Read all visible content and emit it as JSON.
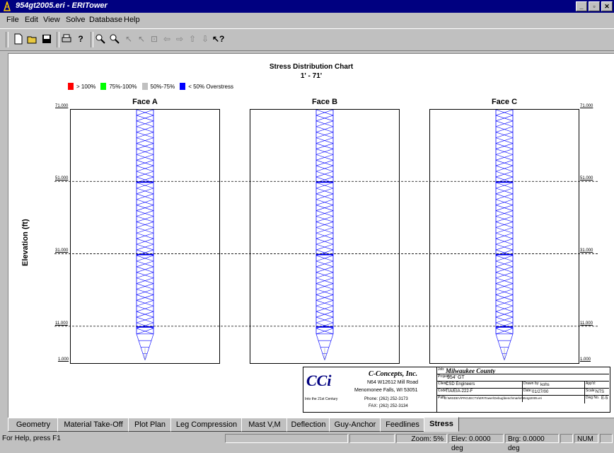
{
  "window": {
    "title": "954gt2005.eri - ERITower"
  },
  "menu": [
    "File",
    "Edit",
    "View",
    "Solve",
    "Database",
    "Help"
  ],
  "toolbar_icons": [
    "new-icon",
    "open-icon",
    "save-icon",
    "print-icon",
    "help-about-icon",
    "zoom-in-icon",
    "zoom-out-icon",
    "select-icon",
    "pointer-icon",
    "fit-icon",
    "pan-left-icon",
    "pan-right-icon",
    "pan-up-icon",
    "pan-down-icon",
    "context-help-icon"
  ],
  "chart": {
    "title": "Stress Distribution Chart",
    "subtitle": "1' - 71'",
    "ylabel": "Elevation (ft)",
    "legend": [
      {
        "label": "> 100%",
        "color": "#ff0000"
      },
      {
        "label": "75%-100%",
        "color": "#00ff00"
      },
      {
        "label": "50%-75%",
        "color": "#c0c0c0"
      },
      {
        "label": "< 50% Overstress",
        "color": "#0000ff"
      }
    ],
    "faces": [
      "Face A",
      "Face B",
      "Face C"
    ],
    "ticks": [
      "71.000",
      "51.000",
      "31.000",
      "11.000",
      "1.000"
    ]
  },
  "chart_data": {
    "type": "other",
    "title": "Stress Distribution Chart",
    "subtitle": "1' - 71'",
    "ylabel": "Elevation (ft)",
    "ylim": [
      1,
      71
    ],
    "yticks": [
      71,
      51,
      31,
      11,
      1
    ],
    "series": [
      {
        "name": "Face A",
        "stress_category": "< 50% Overstress"
      },
      {
        "name": "Face B",
        "stress_category": "< 50% Overstress"
      },
      {
        "name": "Face C",
        "stress_category": "< 50% Overstress"
      }
    ],
    "section_breaks_ft": [
      51,
      31,
      11
    ]
  },
  "titleblock": {
    "logo": "CCi",
    "tagline": "Into the 21st Century",
    "company": "C-Concepts, Inc.",
    "address1": "N64 W12612 Mill Road",
    "address2": "Menomonee Falls, WI 53051",
    "phone": "Phone: (262) 252-3173",
    "fax": "FAX: (262) 252-3134",
    "job_label": "Job:",
    "job": "Milwaukee County",
    "project_label": "Project:",
    "project": "954' GT",
    "client_label": "Client:",
    "client": "CSD Engineers",
    "drawn_label": "Drawn by:",
    "drawn": "kohs",
    "appd_label": "App'd:",
    "appd": "",
    "code_label": "Code:",
    "code": "TIA/EIA-222-F",
    "date_label": "Date:",
    "date": "01/27/00",
    "scale_label": "Scale:",
    "scale": "NTS",
    "path_label": "Path:",
    "path": "D:\\MISDEV\\PROJECTS\\ERITower\\Debug\\benchmarks\\954gt2005.eri",
    "dwg_label": "Dwg No.",
    "dwg": "E-5"
  },
  "tabs": [
    "Geometry",
    "Material Take-Off",
    "Plot Plan",
    "Leg Compression",
    "Mast V,M",
    "Deflection",
    "Guy-Anchor",
    "Feedlines",
    "Stress"
  ],
  "active_tab": "Stress",
  "status": {
    "help": "For Help, press F1",
    "zoom": "Zoom: 5%",
    "elev": "Elev: 0.0000 deg",
    "brg": "Brg: 0.0000 deg",
    "num": "NUM"
  }
}
